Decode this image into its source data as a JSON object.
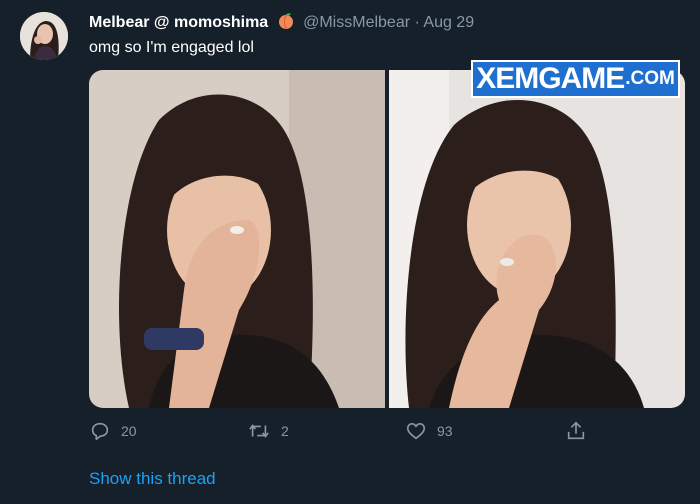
{
  "tweet": {
    "display_name": "Melbear @ momoshima",
    "handle": "@MissMelbear",
    "separator": "·",
    "date": "Aug 29",
    "text": "omg so I'm engaged lol"
  },
  "actions": {
    "reply_count": "20",
    "retweet_count": "2",
    "like_count": "93"
  },
  "show_thread_label": "Show this thread",
  "watermark": {
    "main": "XEMGAME",
    "suffix": ".COM"
  },
  "icons": {
    "peach": "peach-emoji-icon",
    "reply": "reply-icon",
    "retweet": "retweet-icon",
    "like": "heart-icon",
    "share": "share-icon"
  },
  "colors": {
    "background": "#15202b",
    "secondary_text": "#8899a6",
    "link": "#1da1f2",
    "watermark_bg": "#1f6fd0"
  }
}
